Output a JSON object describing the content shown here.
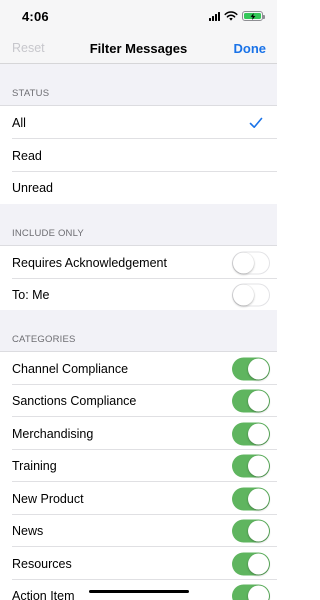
{
  "status_bar": {
    "time": "4:06"
  },
  "nav": {
    "left_label": "Reset",
    "title": "Filter Messages",
    "right_label": "Done"
  },
  "sections": {
    "status": {
      "header": "STATUS",
      "items": [
        {
          "label": "All",
          "selected": true
        },
        {
          "label": "Read",
          "selected": false
        },
        {
          "label": "Unread",
          "selected": false
        }
      ]
    },
    "include_only": {
      "header": "INCLUDE ONLY",
      "items": [
        {
          "label": "Requires Acknowledgement",
          "on": false
        },
        {
          "label": "To: Me",
          "on": false
        }
      ]
    },
    "categories": {
      "header": "CATEGORIES",
      "items": [
        {
          "label": "Channel Compliance",
          "on": true
        },
        {
          "label": "Sanctions Compliance",
          "on": true
        },
        {
          "label": "Merchandising",
          "on": true
        },
        {
          "label": "Training",
          "on": true
        },
        {
          "label": "New Product",
          "on": true
        },
        {
          "label": "News",
          "on": true
        },
        {
          "label": "Resources",
          "on": true
        },
        {
          "label": "Action Item",
          "on": true
        }
      ]
    }
  },
  "colors": {
    "accent": "#1a73e8",
    "toggle_on": "#5fb55f",
    "battery": "#34c759"
  }
}
